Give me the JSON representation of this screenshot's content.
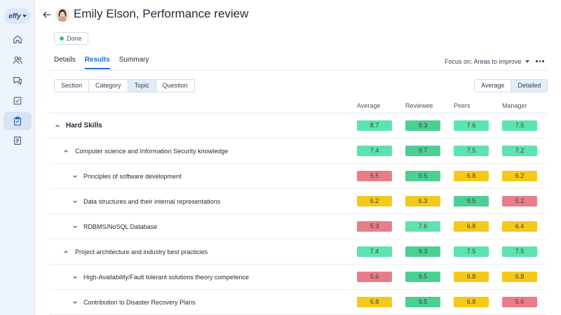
{
  "brand": {
    "logo_text": "effy"
  },
  "sidebar": {
    "items": [
      {
        "icon": "home-icon",
        "active": false
      },
      {
        "icon": "people-icon",
        "active": false
      },
      {
        "icon": "chat-icon",
        "active": false
      },
      {
        "icon": "checkbox-icon",
        "active": false
      },
      {
        "icon": "clipboard-icon",
        "active": true
      },
      {
        "icon": "document-icon",
        "active": false
      }
    ]
  },
  "header": {
    "title": "Emily Elson, Performance review",
    "status": "Done"
  },
  "tabs": [
    {
      "label": "Details",
      "active": false
    },
    {
      "label": "Results",
      "active": true
    },
    {
      "label": "Summary",
      "active": false
    }
  ],
  "focus": {
    "label": "Focus on: Areas to improve"
  },
  "grouping": [
    {
      "label": "Section",
      "active": false
    },
    {
      "label": "Category",
      "active": false
    },
    {
      "label": "Topic",
      "active": true
    },
    {
      "label": "Question",
      "active": false
    }
  ],
  "view": [
    {
      "label": "Average",
      "active": false
    },
    {
      "label": "Detailed",
      "active": true
    }
  ],
  "columns": [
    "Average",
    "Reviewee",
    "Peers",
    "Manager"
  ],
  "colors": {
    "green": "#5de3ad",
    "dark_green": "#4ccf93",
    "yellow": "#f4c91a",
    "red": "#e87d88",
    "accent": "#1e6fd0"
  },
  "rows": [
    {
      "label": "Hard Skills",
      "level": 0,
      "expanded": true,
      "scores": [
        {
          "v": "8.7",
          "c": "green"
        },
        {
          "v": "9.3",
          "c": "dark_green"
        },
        {
          "v": "7.6",
          "c": "green"
        },
        {
          "v": "7.5",
          "c": "green"
        }
      ]
    },
    {
      "label": "Computer science and Information Security knowledge",
      "level": 1,
      "expanded": true,
      "scores": [
        {
          "v": "7.4",
          "c": "green"
        },
        {
          "v": "9.7",
          "c": "dark_green"
        },
        {
          "v": "7.5",
          "c": "green"
        },
        {
          "v": "7.2",
          "c": "green"
        }
      ]
    },
    {
      "label": "Principles of software development",
      "level": 2,
      "expanded": false,
      "scores": [
        {
          "v": "5.5",
          "c": "red"
        },
        {
          "v": "9.5",
          "c": "dark_green"
        },
        {
          "v": "6.8",
          "c": "yellow"
        },
        {
          "v": "6.2",
          "c": "yellow"
        }
      ]
    },
    {
      "label": "Data structures and their internal representations",
      "level": 2,
      "expanded": false,
      "scores": [
        {
          "v": "6.2",
          "c": "yellow"
        },
        {
          "v": "6.3",
          "c": "yellow"
        },
        {
          "v": "9.5",
          "c": "dark_green"
        },
        {
          "v": "5.2",
          "c": "red"
        }
      ]
    },
    {
      "label": "RDBMS/NoSQL Database",
      "level": 2,
      "expanded": false,
      "scores": [
        {
          "v": "5.3",
          "c": "red"
        },
        {
          "v": "7.6",
          "c": "green"
        },
        {
          "v": "6.8",
          "c": "yellow"
        },
        {
          "v": "6.4",
          "c": "yellow"
        }
      ]
    },
    {
      "label": "Project architecture and industry best practicies",
      "level": 1,
      "expanded": true,
      "scores": [
        {
          "v": "7.4",
          "c": "green"
        },
        {
          "v": "9.3",
          "c": "dark_green"
        },
        {
          "v": "7.5",
          "c": "green"
        },
        {
          "v": "7.5",
          "c": "green"
        }
      ]
    },
    {
      "label": "High-Availability/Fault tolerant solutions theory competence",
      "level": 2,
      "expanded": false,
      "scores": [
        {
          "v": "5.6",
          "c": "red"
        },
        {
          "v": "9.5",
          "c": "dark_green"
        },
        {
          "v": "6.8",
          "c": "yellow"
        },
        {
          "v": "6.8",
          "c": "yellow"
        }
      ]
    },
    {
      "label": "Contribution to Disaster Recovery Plans",
      "level": 2,
      "expanded": false,
      "scores": [
        {
          "v": "6.8",
          "c": "yellow"
        },
        {
          "v": "9.5",
          "c": "dark_green"
        },
        {
          "v": "6.8",
          "c": "yellow"
        },
        {
          "v": "5.6",
          "c": "red"
        }
      ]
    }
  ]
}
